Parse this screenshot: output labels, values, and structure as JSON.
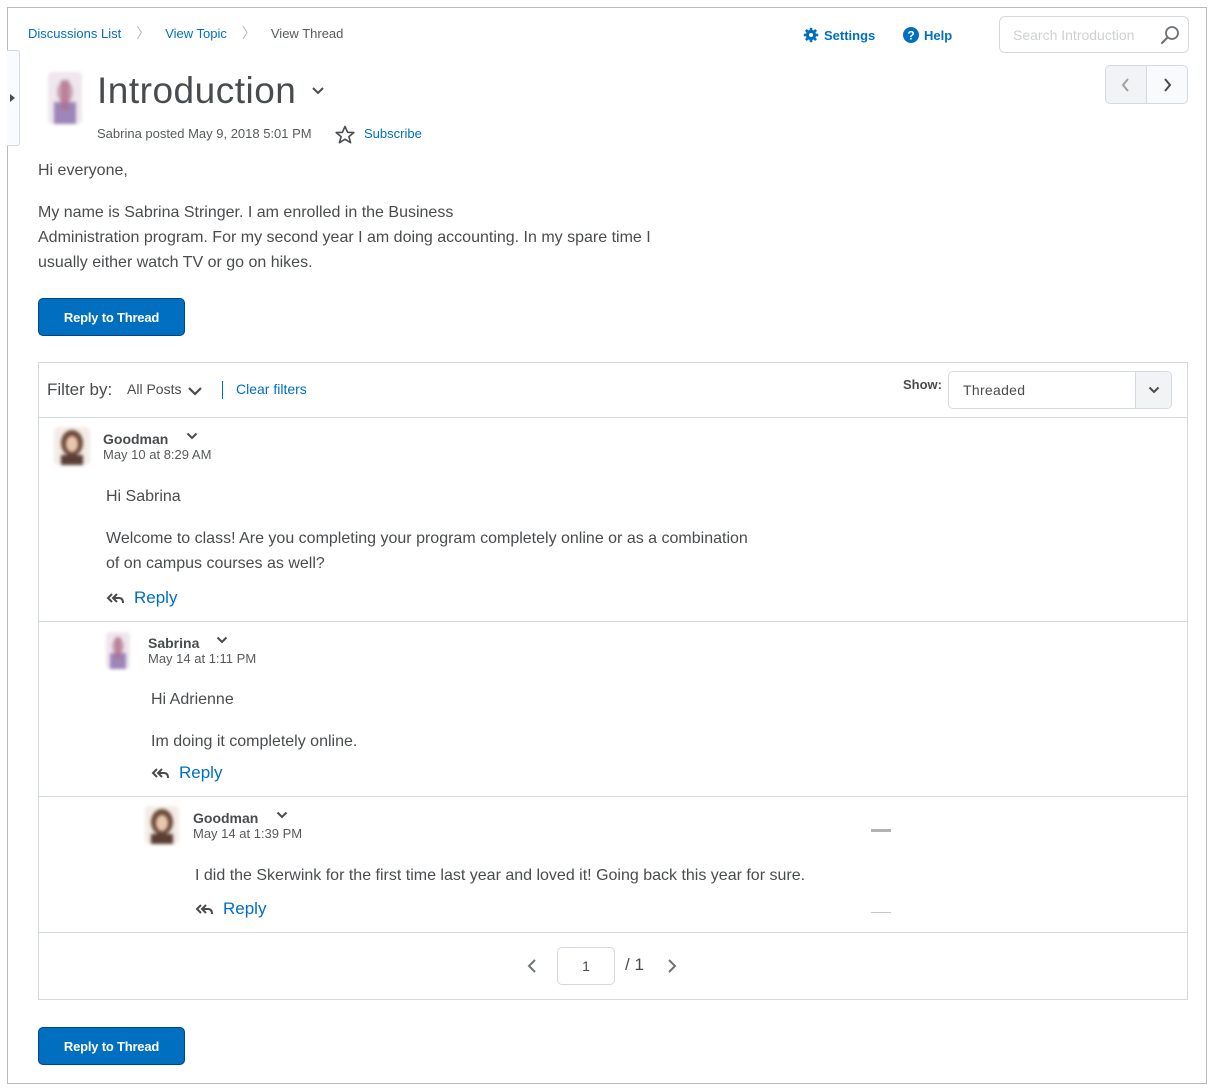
{
  "breadcrumb": [
    "Discussions List",
    "View Topic",
    "View Thread"
  ],
  "header": {
    "settings_label": "Settings",
    "help_label": "Help",
    "search_placeholder": "Search Introduction"
  },
  "thread": {
    "title": "Introduction",
    "posted": "Sabrina posted May 9, 2018 5:01 PM",
    "subscribe_label": "Subscribe",
    "body": [
      "Hi everyone,",
      "My name is Sabrina Stringer. I am enrolled in the Business",
      "Administration program. For my second year I am doing accounting. In my spare time I",
      "usually either watch TV or go on hikes."
    ],
    "reply_button": "Reply to Thread"
  },
  "filter": {
    "label": "Filter by:",
    "value": "All Posts",
    "clear_label": "Clear filters",
    "show_label": "Show:",
    "show_value": "Threaded"
  },
  "posts": [
    {
      "author": "Goodman",
      "date": "May 10 at 8:29 AM",
      "greeting": "Hi Sabrina",
      "body": [
        "Welcome to class! Are you completing your program completely online or as a combination",
        "of on campus courses as well?"
      ],
      "reply_label": "Reply"
    },
    {
      "author": "Sabrina",
      "date": "May 14 at 1:11 PM",
      "greeting": "Hi Adrienne",
      "body": [
        "Im doing it completely online."
      ],
      "reply_label": "Reply"
    },
    {
      "author": "Goodman",
      "date": "May 14 at 1:39 PM",
      "body": [
        "I did the Skerwink for the first time last year and loved it! Going back this year for sure."
      ],
      "reply_label": "Reply"
    }
  ],
  "pager": {
    "current": "1",
    "total": "/ 1"
  },
  "colors": {
    "link": "#006fbf",
    "button": "#006fbf",
    "border": "#d3d9e3"
  }
}
